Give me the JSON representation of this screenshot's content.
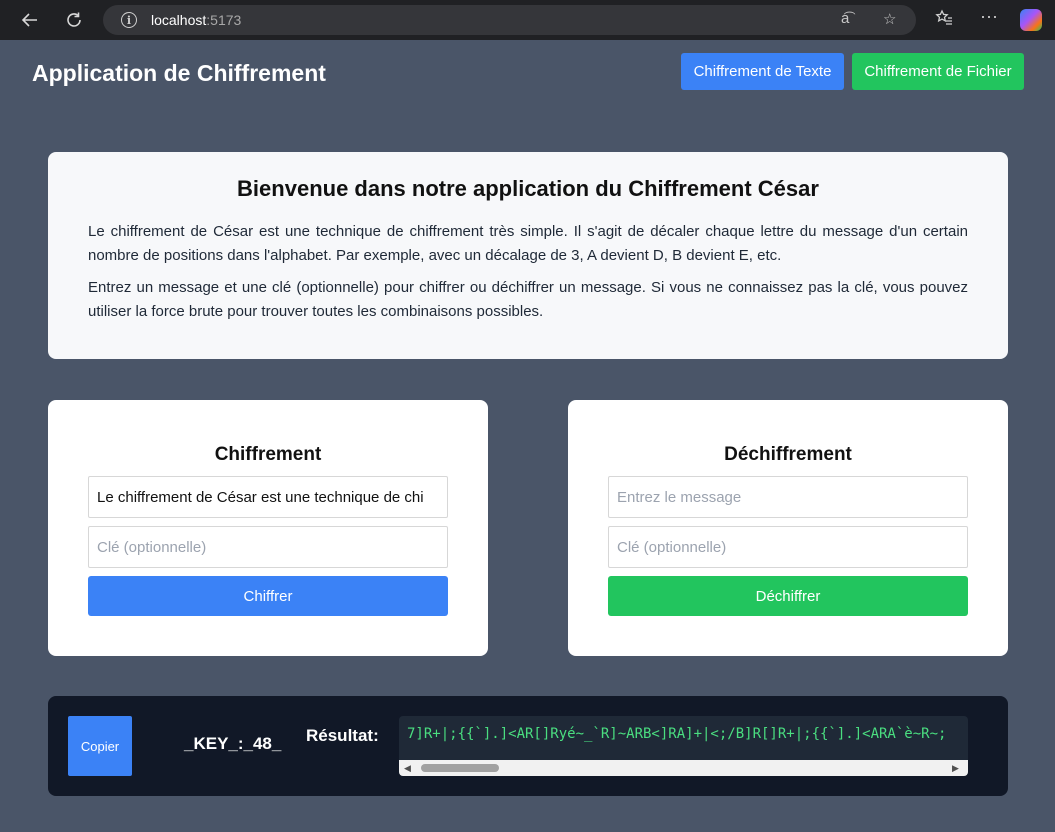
{
  "browser": {
    "url_host": "localhost",
    "url_port": ":5173",
    "icons": [
      "back-arrow-icon",
      "reload-icon",
      "site-info-icon",
      "read-aloud-icon",
      "favorite-star-icon",
      "favorites-icon",
      "more-icon",
      "copilot-icon"
    ]
  },
  "header": {
    "title": "Application de Chiffrement",
    "text_mode_label": "Chiffrement de Texte",
    "file_mode_label": "Chiffrement de Fichier"
  },
  "welcome": {
    "title": "Bienvenue dans notre application du Chiffrement César",
    "paragraph_1": "Le chiffrement de César est une technique de chiffrement très simple. Il s'agit de décaler chaque lettre du message d'un certain nombre de positions dans l'alphabet. Par exemple, avec un décalage de 3, A devient D, B devient E, etc.",
    "paragraph_2": "Entrez un message et une clé (optionnelle) pour chiffrer ou déchiffrer un message. Si vous ne connaissez pas la clé, vous pouvez utiliser la force brute pour trouver toutes les combinaisons possibles."
  },
  "encrypt": {
    "title": "Chiffrement",
    "message_value": "Le chiffrement de César est une technique de chi",
    "message_placeholder": "Entrez le message",
    "key_value": "",
    "key_placeholder": "Clé (optionnelle)",
    "button_label": "Chiffrer"
  },
  "decrypt": {
    "title": "Déchiffrement",
    "message_value": "",
    "message_placeholder": "Entrez le message",
    "key_value": "",
    "key_placeholder": "Clé (optionnelle)",
    "button_label": "Déchiffrer"
  },
  "result": {
    "copy_label": "Copier",
    "key_text": "_KEY_:_48_",
    "label": "Résultat:",
    "value": "7]R+|;{{`].]<AR[]Ryé~_`R]~ARB<]RA]+|<;/B]R[]R+|;{{`].]<ARA`è~R~;"
  },
  "colors": {
    "page_bg": "#4a5568",
    "primary_blue": "#3b82f6",
    "primary_green": "#22c55e",
    "result_bg": "#111827",
    "result_text": "#4ade80"
  }
}
